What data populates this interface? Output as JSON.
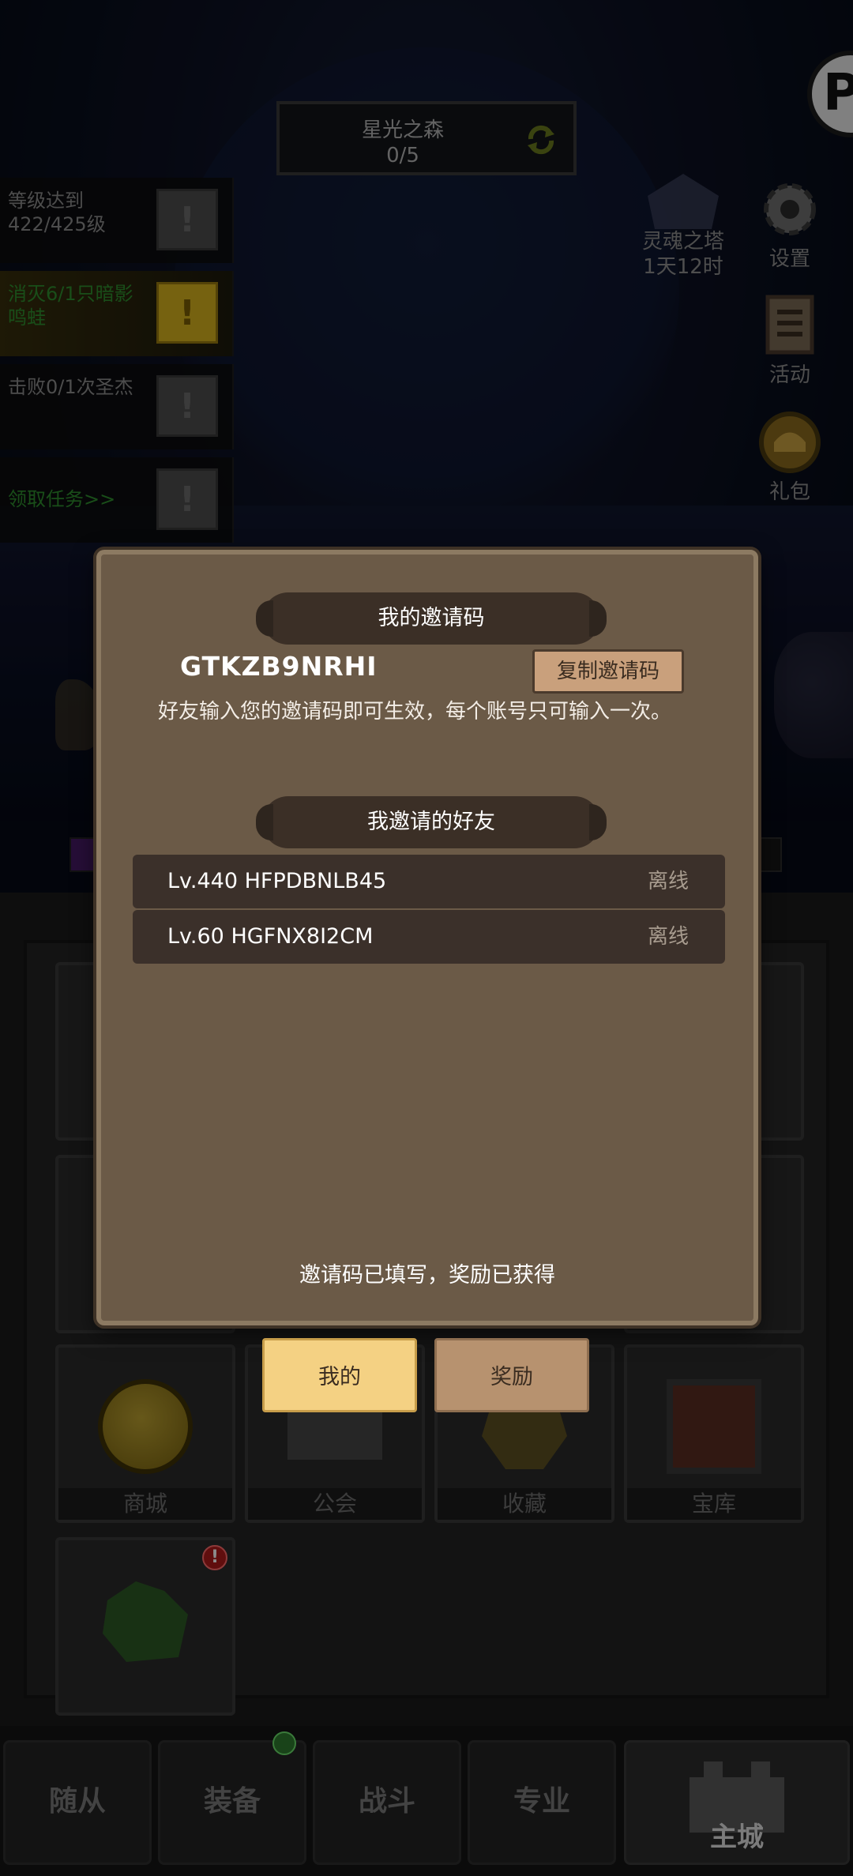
{
  "colors": {
    "modal_bg": "#6b5a47",
    "ribbon_bg": "#3b2f26",
    "active_tab": "#f4d183",
    "inactive_tab": "#b7926f",
    "quest_done_text": "#2f8f2f"
  },
  "stage": {
    "name": "星光之森",
    "progress": "0/5",
    "refresh_icon": "refresh-icon"
  },
  "quests": [
    {
      "text": "等级达到422/425级"
    },
    {
      "text": "消灭6/1只暗影鸣蛙"
    },
    {
      "text": "击败0/1次圣杰"
    },
    {
      "text": "领取任务>>"
    }
  ],
  "tower": {
    "name": "灵魂之塔",
    "time": "1天12时"
  },
  "side_buttons": {
    "settings": "设置",
    "activity": "活动",
    "gift": "礼包"
  },
  "modal": {
    "invite_title": "我的邀请码",
    "invite_code": "GTKZB9NRHI",
    "copy_button": "复制邀请码",
    "description": "好友输入您的邀请码即可生效，每个账号只可输入一次。",
    "friends_title": "我邀请的好友",
    "friends": [
      {
        "name": "Lv.440 HFPDBNLB45",
        "status": "离线"
      },
      {
        "name": "Lv.60 HGFNX8I2CM",
        "status": "离线"
      }
    ],
    "footer": "邀请码已填写，奖励已获得"
  },
  "modal_tabs": {
    "mine": "我的",
    "reward": "奖励"
  },
  "tiles": {
    "shop": "商城",
    "guild": "公会",
    "collection": "收藏",
    "treasury": "宝库",
    "notice": "!"
  },
  "bottom_nav": {
    "followers": "随从",
    "equipment": "装备",
    "battle": "战斗",
    "profession": "专业",
    "main_city": "主城"
  }
}
